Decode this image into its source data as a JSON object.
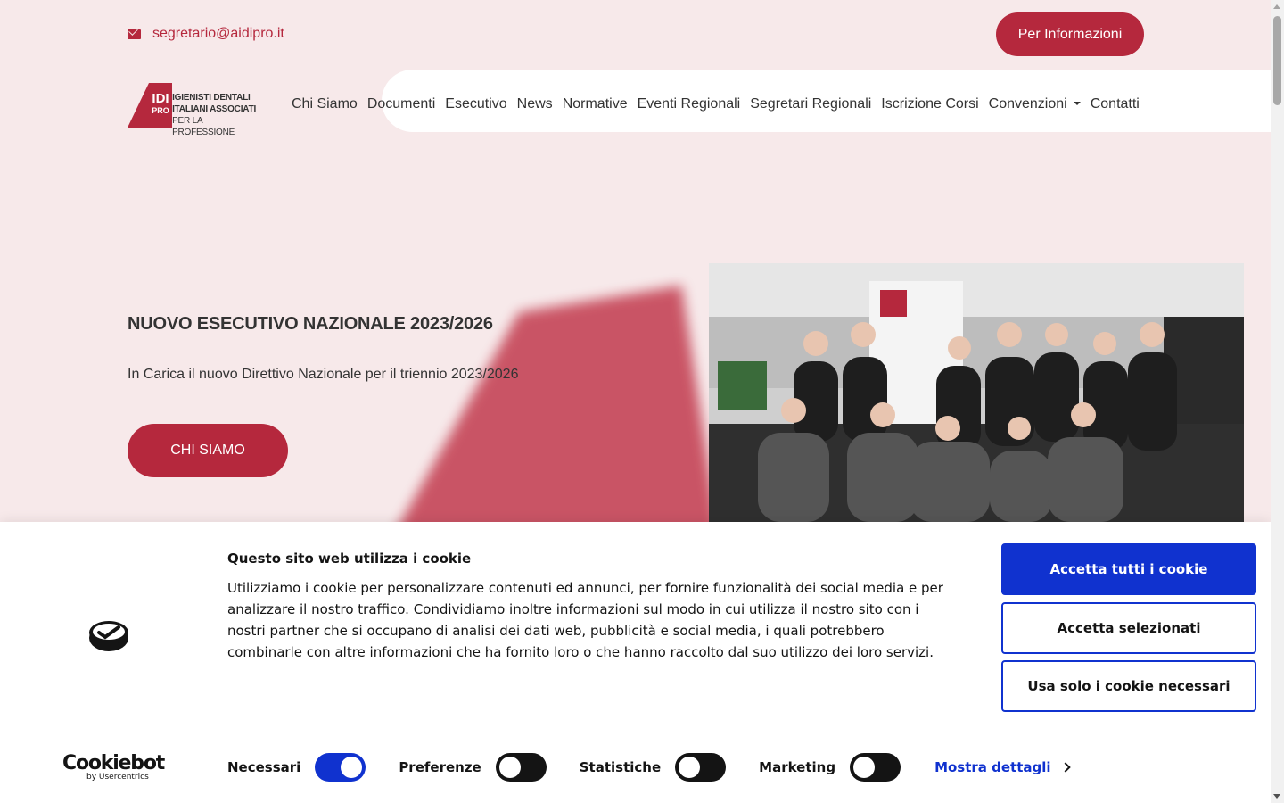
{
  "topbar": {
    "email": "segretario@aidipro.it",
    "info_button": "Per Informazioni"
  },
  "logo": {
    "mark_big": "IDI",
    "mark_small": "PRO",
    "line1": "IGIENISTI DENTALI",
    "line2": "ITALIANI ASSOCIATI",
    "line3": "PER LA PROFESSIONE"
  },
  "nav": {
    "items": [
      "Chi Siamo",
      "Documenti",
      "Esecutivo",
      "News",
      "Normative",
      "Eventi Regionali",
      "Segretari Regionali",
      "Iscrizione Corsi",
      "Convenzioni",
      "Contatti"
    ]
  },
  "hero": {
    "title": "NUOVO ESECUTIVO NAZIONALE 2023/2026",
    "subtitle": "In Carica il nuovo Direttivo Nazionale per il triennio 2023/2026",
    "button": "CHI SIAMO"
  },
  "cookie": {
    "title": "Questo sito web utilizza i cookie",
    "text": "Utilizziamo i cookie per personalizzare contenuti ed annunci, per fornire funzionalità dei social media e per analizzare il nostro traffico. Condividiamo inoltre informazioni sul modo in cui utilizza il nostro sito con i nostri partner che si occupano di analisi dei dati web, pubblicità e social media, i quali potrebbero combinarle con altre informazioni che ha fornito loro o che hanno raccolto dal suo utilizzo dei loro servizi.",
    "accept_all": "Accetta tutti i cookie",
    "accept_selected": "Accetta selezionati",
    "necessary_only": "Usa solo i cookie necessari",
    "brand": "Cookiebot",
    "brand_sub": "by Usercentrics",
    "toggles": [
      {
        "label": "Necessari",
        "on": true
      },
      {
        "label": "Preferenze",
        "on": false
      },
      {
        "label": "Statistiche",
        "on": false
      },
      {
        "label": "Marketing",
        "on": false
      }
    ],
    "details": "Mostra dettagli"
  },
  "colors": {
    "brand_red": "#b5283d",
    "background": "#f7e9ea",
    "cookie_blue": "#1032cf"
  }
}
